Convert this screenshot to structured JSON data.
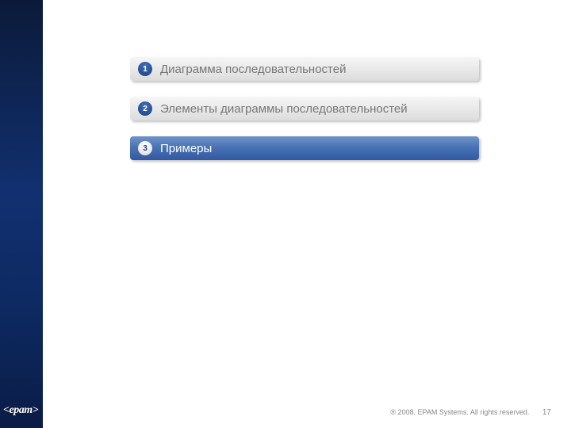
{
  "agenda": {
    "items": [
      {
        "num": "1",
        "label": "Диаграмма последовательностей",
        "active": false
      },
      {
        "num": "2",
        "label": "Элементы диаграммы последовательностей",
        "active": false
      },
      {
        "num": "3",
        "label": "Примеры",
        "active": true
      }
    ]
  },
  "footer": {
    "copyright": "® 2008. EPAM Systems. All rights reserved.",
    "page": "17"
  },
  "logo": {
    "text": "<epam>"
  }
}
